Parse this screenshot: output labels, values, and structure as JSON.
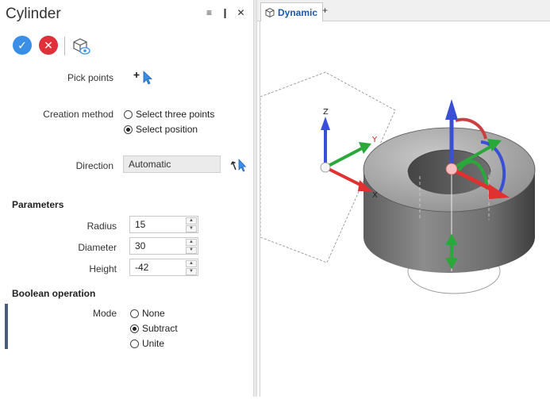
{
  "panel": {
    "title": "Cylinder",
    "header_icons": [
      "menu-icon",
      "pin-icon",
      "close-icon"
    ],
    "pick_points_label": "Pick points",
    "creation_method": {
      "label": "Creation method",
      "options": [
        "Select three points",
        "Select position"
      ],
      "selected": "Select position"
    },
    "direction": {
      "label": "Direction",
      "value": "Automatic"
    },
    "parameters": {
      "title": "Parameters",
      "radius": {
        "label": "Radius",
        "value": "15"
      },
      "diameter": {
        "label": "Diameter",
        "value": "30"
      },
      "height": {
        "label": "Height",
        "value": "-42"
      }
    },
    "boolean": {
      "title": "Boolean operation",
      "mode_label": "Mode",
      "options": [
        "None",
        "Subtract",
        "Unite"
      ],
      "selected": "Subtract"
    }
  },
  "viewport": {
    "tab_label": "Dynamic",
    "add_tab": "+",
    "axis_labels": {
      "x": "X",
      "y": "Y",
      "z": "Z"
    }
  },
  "colors": {
    "accent": "#3a8ee6",
    "cancel": "#e0303a",
    "tab_text": "#1a5aa8",
    "axis_x": "#e03030",
    "axis_y": "#2aa83a",
    "axis_z": "#3a4fd8"
  }
}
